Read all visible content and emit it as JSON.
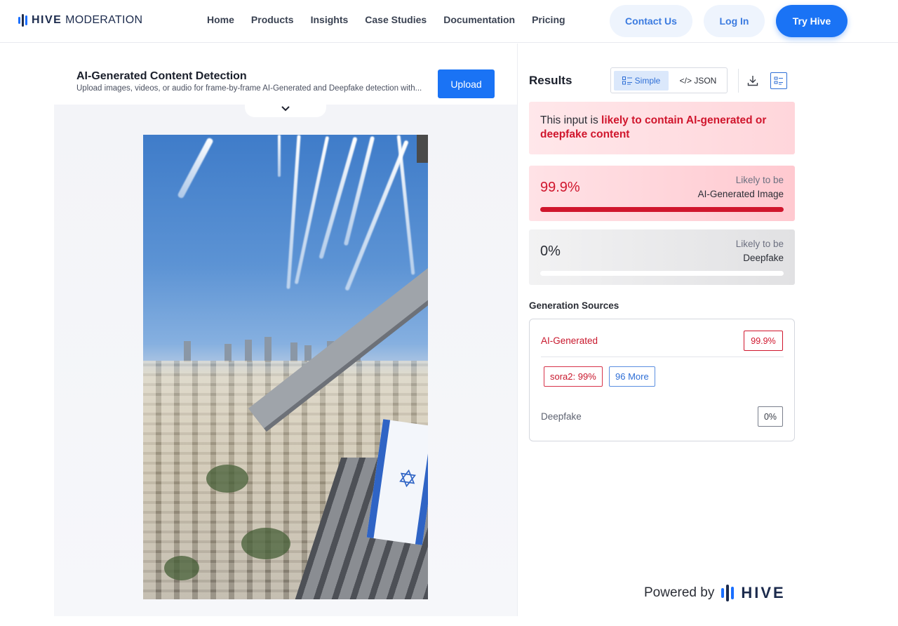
{
  "brand": {
    "name_bold": "HIVE",
    "name_thin": "MODERATION"
  },
  "nav": {
    "links": [
      "Home",
      "Products",
      "Insights",
      "Case Studies",
      "Documentation",
      "Pricing"
    ],
    "contact_label": "Contact Us",
    "login_label": "Log In",
    "try_label": "Try Hive"
  },
  "tool": {
    "title": "AI-Generated Content Detection",
    "subtitle": "Upload images, videos, or audio for frame-by-frame AI-Generated and Deepfake detection with...",
    "upload_label": "Upload"
  },
  "results": {
    "title": "Results",
    "view_simple": "Simple",
    "view_json": "</> JSON",
    "verdict_prefix": "This input is ",
    "verdict_highlight": "likely to contain AI-generated or deepfake content",
    "scores": [
      {
        "value": "99.9%",
        "fraction": 0.999,
        "label_top": "Likely to be",
        "label_bottom": "AI-Generated Image"
      },
      {
        "value": "0%",
        "fraction": 0.0,
        "label_top": "Likely to be",
        "label_bottom": "Deepfake"
      }
    ],
    "sources_title": "Generation Sources",
    "sources": {
      "ai_label": "AI-Generated",
      "ai_value": "99.9%",
      "chip_sora": "sora2: 99%",
      "chip_more": "96 More",
      "deepfake_label": "Deepfake",
      "deepfake_value": "0%"
    },
    "powered_by": "Powered by",
    "powered_brand": "HIVE"
  },
  "colors": {
    "accent": "#1a73f5",
    "danger": "#d0162d"
  },
  "icons": [
    "chevron-down-icon",
    "simple-view-icon",
    "download-icon",
    "list-view-icon"
  ]
}
